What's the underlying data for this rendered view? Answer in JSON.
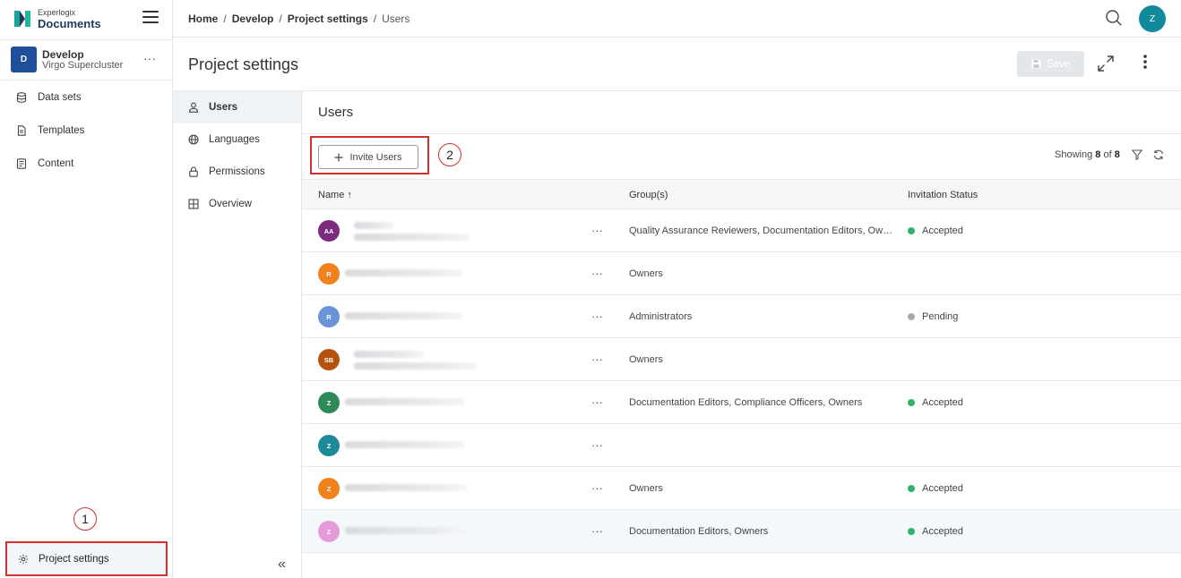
{
  "app": {
    "brand_small": "Experlogix",
    "brand_big": "Documents"
  },
  "project": {
    "initial": "D",
    "name": "Develop",
    "subtitle": "Virgo Supercluster",
    "menu": "···"
  },
  "sidebar": {
    "items": [
      {
        "label": "Data sets",
        "icon": "database-icon"
      },
      {
        "label": "Templates",
        "icon": "document-icon"
      },
      {
        "label": "Content",
        "icon": "content-icon"
      }
    ],
    "bottom_item": "Project settings"
  },
  "breadcrumb": {
    "home": "Home",
    "develop": "Develop",
    "settings": "Project settings",
    "current": "Users",
    "sep": "/"
  },
  "user": {
    "initial": "Z",
    "color": "#138a9b"
  },
  "page": {
    "title": "Project settings",
    "save_label": "Save"
  },
  "settings_nav": {
    "items": [
      {
        "label": "Users",
        "icon": "user-icon"
      },
      {
        "label": "Languages",
        "icon": "globe-icon"
      },
      {
        "label": "Permissions",
        "icon": "lock-icon"
      },
      {
        "label": "Overview",
        "icon": "grid-icon"
      }
    ],
    "collapse": "«"
  },
  "users": {
    "title": "Users",
    "invite_label": "Invite Users",
    "showing_prefix": "Showing",
    "showing_count": "8",
    "showing_of": "of",
    "showing_total": "8",
    "columns": {
      "name": "Name ↑",
      "groups": "Group(s)",
      "status": "Invitation Status"
    },
    "rows": [
      {
        "initials": "AA",
        "color": "#7b2a7e",
        "groups": "Quality Assurance Reviewers, Documentation Editors, Owners",
        "status": "Accepted",
        "status_color": "#2db36b"
      },
      {
        "initials": "R",
        "color": "#f0821e",
        "groups": "Owners",
        "status": "",
        "status_color": ""
      },
      {
        "initials": "R",
        "color": "#6a93d8",
        "groups": "Administrators",
        "status": "Pending",
        "status_color": "#a9abad"
      },
      {
        "initials": "SB",
        "color": "#b5520e",
        "groups": "Owners",
        "status": "",
        "status_color": ""
      },
      {
        "initials": "Z",
        "color": "#2e8b57",
        "groups": "Documentation Editors, Compliance Officers, Owners",
        "status": "Accepted",
        "status_color": "#2db36b"
      },
      {
        "initials": "Z",
        "color": "#1d8a99",
        "groups": "",
        "status": "",
        "status_color": ""
      },
      {
        "initials": "Z",
        "color": "#f0821e",
        "groups": "Owners",
        "status": "Accepted",
        "status_color": "#2db36b"
      },
      {
        "initials": "Z",
        "color": "#e49ad8",
        "groups": "Documentation Editors, Owners",
        "status": "Accepted",
        "status_color": "#2db36b"
      }
    ],
    "row_menu": "···"
  },
  "annotations": {
    "one": "1",
    "two": "2"
  }
}
